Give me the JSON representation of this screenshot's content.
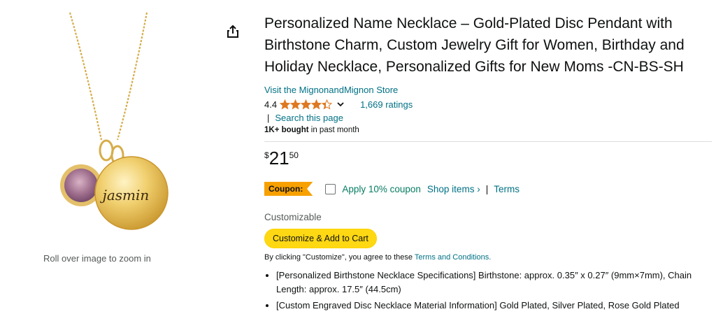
{
  "product": {
    "title": "Personalized Name Necklace – Gold-Plated Disc Pendant with Birthstone Charm, Custom Jewelry Gift for Women, Birthday and Holiday Necklace, Personalized Gifts for New Moms -CN-BS-SH",
    "store_link": "Visit the MignonandMignon Store",
    "rating": "4.4",
    "stars": 4.4,
    "ratings_count": "1,669 ratings",
    "search_sep": "|",
    "search_link": "Search this page",
    "bought_bold": "1K+ bought",
    "bought_rest": " in past month",
    "engraving": "jasmin"
  },
  "price": {
    "symbol": "$",
    "whole": "21",
    "fraction": "50"
  },
  "coupon": {
    "badge": "Coupon:",
    "apply": "Apply 10% coupon",
    "shop": "Shop items ›",
    "pipe": "|",
    "terms": "Terms"
  },
  "customize": {
    "label": "Customizable",
    "button": "Customize & Add to Cart",
    "agree_prefix": "By clicking \"Customize\", you agree to these ",
    "agree_link": "Terms and Conditions."
  },
  "bullets": [
    "[Personalized Birthstone Necklace Specifications] Birthstone: approx. 0.35″ x 0.27″ (9mm×7mm), Chain Length: approx. 17.5″ (44.5cm)",
    "[Custom Engraved Disc Necklace Material Information] Gold Plated, Silver Plated, Rose Gold Plated"
  ],
  "image": {
    "zoom_hint": "Roll over image to zoom in"
  },
  "colors": {
    "link": "#007185",
    "star": "#de7921",
    "coupon_badge": "#f7a000",
    "cta": "#ffd814",
    "apply_green": "#067d62"
  },
  "icons": {
    "share": "share-icon",
    "chevron": "chevron-down-icon",
    "star": "star-icon"
  }
}
